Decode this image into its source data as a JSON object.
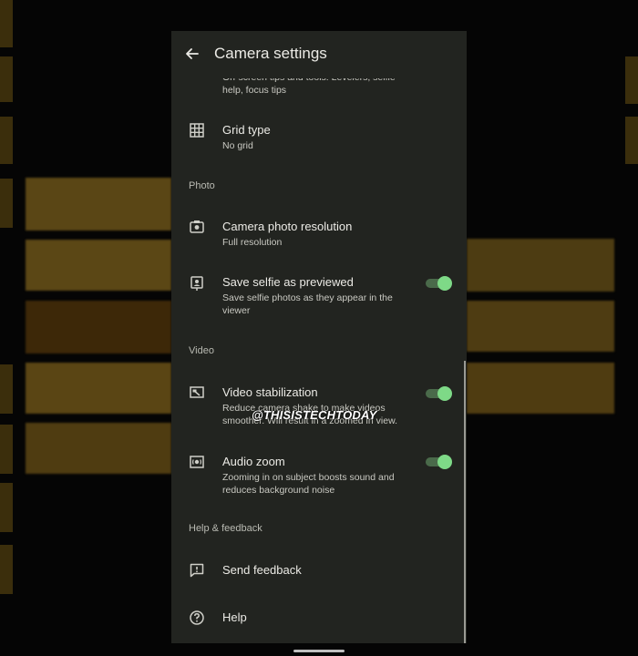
{
  "appbar": {
    "title": "Camera settings"
  },
  "partial_item": {
    "sub": "On-screen tips and tools: Levelers, selfie help, focus tips"
  },
  "grid": {
    "label": "Grid type",
    "sub": "No grid"
  },
  "sections": {
    "photo": "Photo",
    "video": "Video",
    "help": "Help & feedback"
  },
  "photo_resolution": {
    "label": "Camera photo resolution",
    "sub": "Full resolution"
  },
  "selfie": {
    "label": "Save selfie as previewed",
    "sub": "Save selfie photos as they appear in the viewer",
    "on": true
  },
  "stabilization": {
    "label": "Video stabilization",
    "sub": "Reduce camera shake to make videos smoother. Will result in a zoomed in view.",
    "on": true
  },
  "audio_zoom": {
    "label": "Audio zoom",
    "sub": "Zooming in on subject boosts sound and reduces background noise",
    "on": true
  },
  "feedback": {
    "label": "Send feedback"
  },
  "help": {
    "label": "Help"
  },
  "watermark": "@THISISTECHTODAY",
  "colors": {
    "background": "#222420",
    "toggle_thumb": "#7ed987",
    "toggle_track": "#4a6a4a"
  }
}
